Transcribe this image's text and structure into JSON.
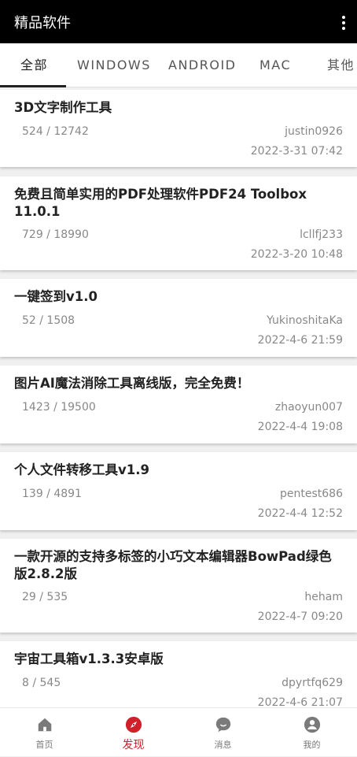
{
  "appbar": {
    "title": "精品软件",
    "more_icon": "more-vert-icon"
  },
  "tabs": [
    {
      "label": "全部",
      "active": true
    },
    {
      "label": "WINDOWS",
      "active": false
    },
    {
      "label": "ANDROID",
      "active": false
    },
    {
      "label": "MAC",
      "active": false
    },
    {
      "label": "其他",
      "active": false
    }
  ],
  "posts": [
    {
      "title": "3D文字制作工具",
      "stats": "524 / 12742",
      "author": "justin0926",
      "date": "2022-3-31 07:42"
    },
    {
      "title": "免费且简单实用的PDF处理软件PDF24 Toolbox 11.0.1",
      "stats": "729 / 18990",
      "author": "lcllfj233",
      "date": "2022-3-20 10:48"
    },
    {
      "title": "一键签到v1.0",
      "stats": "52 / 1508",
      "author": "YukinoshitaKa",
      "date": "2022-4-6 21:59"
    },
    {
      "title": "图片AI魔法消除工具离线版，完全免费！",
      "stats": "1423 / 19500",
      "author": "zhaoyun007",
      "date": "2022-4-4 19:08"
    },
    {
      "title": "个人文件转移工具v1.9",
      "stats": "139 / 4891",
      "author": "pentest686",
      "date": "2022-4-4 12:52"
    },
    {
      "title": "一款开源的支持多标签的小巧文本编辑器BowPad绿色版2.8.2版",
      "stats": "29 / 535",
      "author": "heham",
      "date": "2022-4-7 09:20"
    },
    {
      "title": "宇宙工具箱v1.3.3安卓版",
      "stats": "8 / 545",
      "author": "dpyrtfq629",
      "date": "2022-4-6 21:07"
    }
  ],
  "bottom_nav": [
    {
      "label": "首页",
      "icon": "home-icon",
      "active": false
    },
    {
      "label": "发现",
      "icon": "compass-icon",
      "active": true
    },
    {
      "label": "消息",
      "icon": "chat-icon",
      "active": false
    },
    {
      "label": "我的",
      "icon": "person-icon",
      "active": false
    }
  ],
  "colors": {
    "appbar_bg": "#000000",
    "active_nav": "#d0202a",
    "inactive_icon": "#7a7a7a",
    "meta_text": "#888888"
  }
}
